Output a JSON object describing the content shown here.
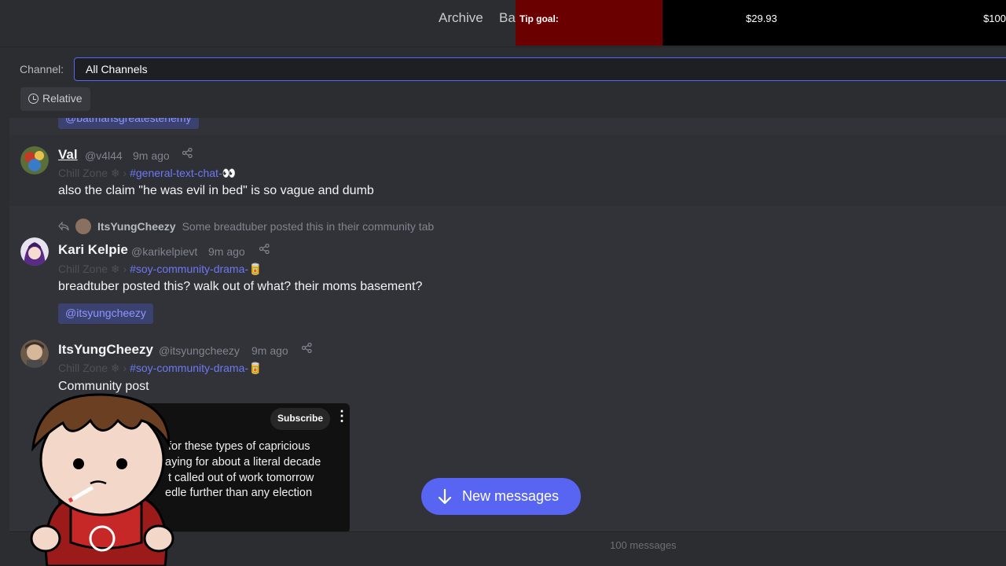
{
  "topbar": {
    "nav_archive": "Archive",
    "nav_partial": "Ba",
    "tip_label": "Tip goal:",
    "tip_current": "$29.93",
    "tip_goal": "$100",
    "tip_progress": 0.3
  },
  "filter": {
    "channel_label": "Channel:",
    "channel_value": "All Channels",
    "time_mode": "Relative"
  },
  "messages": [
    {
      "partial_mention": "@batmansgreatestenemy"
    },
    {
      "author": "Val",
      "handle": "@v4l44",
      "time": "9m ago",
      "server": "Chill Zone ❄",
      "sep": "›",
      "channel": "#general-text-chat-👀",
      "text": "also the claim \"he was evil in bed\" is so vague and dumb"
    },
    {
      "reply_to_author": "ItsYungCheezy",
      "reply_to_text": "Some breadtuber posted this in their community tab",
      "author": "Kari Kelpie",
      "handle": "@karikelpievt",
      "time": "9m ago",
      "server": "Chill Zone ❄",
      "sep": "›",
      "channel": "#soy-community-drama-🥫",
      "text": "breadtuber posted this? walk out of what? their moms basement?",
      "mention": "@itsyungcheezy"
    },
    {
      "author": "ItsYungCheezy",
      "handle": "@itsyungcheezy",
      "time": "9m ago",
      "server": "Chill Zone ❄",
      "sep": "›",
      "channel": "#soy-community-drama-🥫",
      "text": "Community post"
    }
  ],
  "embed": {
    "subscribe_label": "Subscribe",
    "menu_glyph": "⋮",
    "lines": [
      "for these types of capricious",
      "aying for about a literal decade",
      "t called out of work tomorrow",
      "edle further than any election"
    ]
  },
  "new_messages_label": "New messages",
  "message_count": "100 messages",
  "icons": {
    "share": "share-icon",
    "reply": "reply-icon",
    "clock": "clock-icon",
    "arrow": "arrow-down-icon"
  },
  "colors": {
    "accent": "#5865f2",
    "mention_bg": "#3c4270",
    "channel_link": "#6d78f2",
    "tip_fill": "#6b0000"
  }
}
